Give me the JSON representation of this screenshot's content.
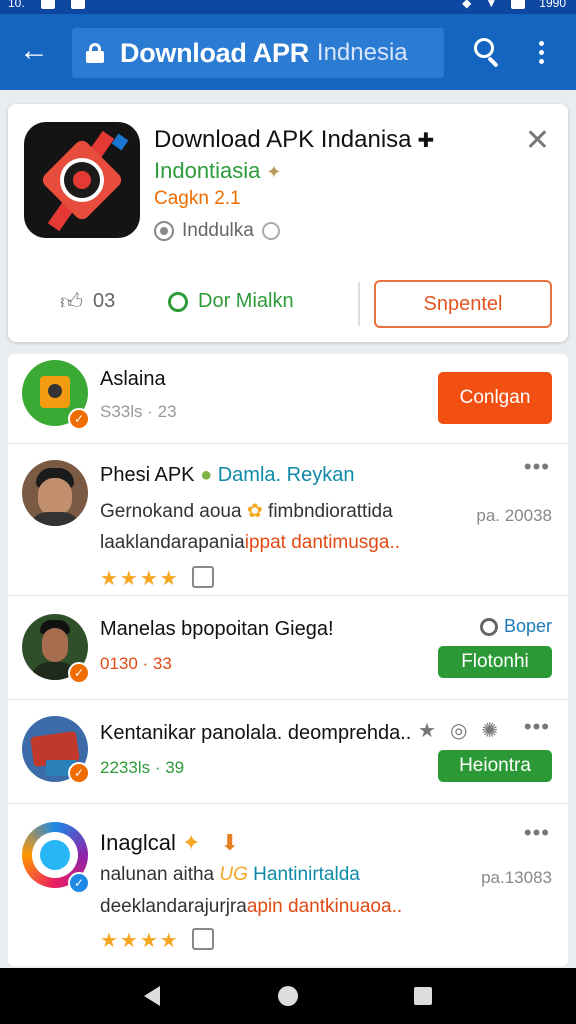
{
  "statusbar": {
    "left_text": "10.",
    "right_text": "1990"
  },
  "appbar": {
    "title": "Download APR",
    "subtitle": "Indnesia"
  },
  "app_card": {
    "title": "Download APK Indanisa",
    "developer": "Indontiasia",
    "version": "Cagkn 2.1",
    "region": "Inddulka",
    "likes": "03",
    "reviewer": "Dor Mialkn",
    "support_button": "Snpentel"
  },
  "list": [
    {
      "name": "Aslaina",
      "meta": "S33ls · 23",
      "button": "Conlgan"
    },
    {
      "name": "Phesi APK",
      "tag": "Damla. Reykan",
      "desc1": "Gernokand aoua",
      "desc1b": "fimbndiorattida",
      "desc2a": "laaklandarapania",
      "desc2b": "ippat dantimusga..",
      "side": "pa. 20038",
      "stars": "★★★★"
    },
    {
      "name": "Manelas bpopoitan Giega!",
      "meta": "0130 · 33",
      "tag": "Boper",
      "button": "Flotonhi"
    },
    {
      "name": "Kentanikar panolala. deomprehda..",
      "meta": "2233ls · 39",
      "button": "Heiontra"
    },
    {
      "name": "Inaglcal",
      "desc1a": "nalunan aitha",
      "desc1b": "UG",
      "desc1c": "Hantinirtalda",
      "desc2a": "deeklandarajurjra",
      "desc2b": "apin dantkinuaoa..",
      "side": "pa.13083",
      "stars": "★★★★"
    }
  ],
  "colors": {
    "appbar": "#1565c0",
    "accent_orange": "#f24f12",
    "accent_green": "#2b9a36"
  }
}
